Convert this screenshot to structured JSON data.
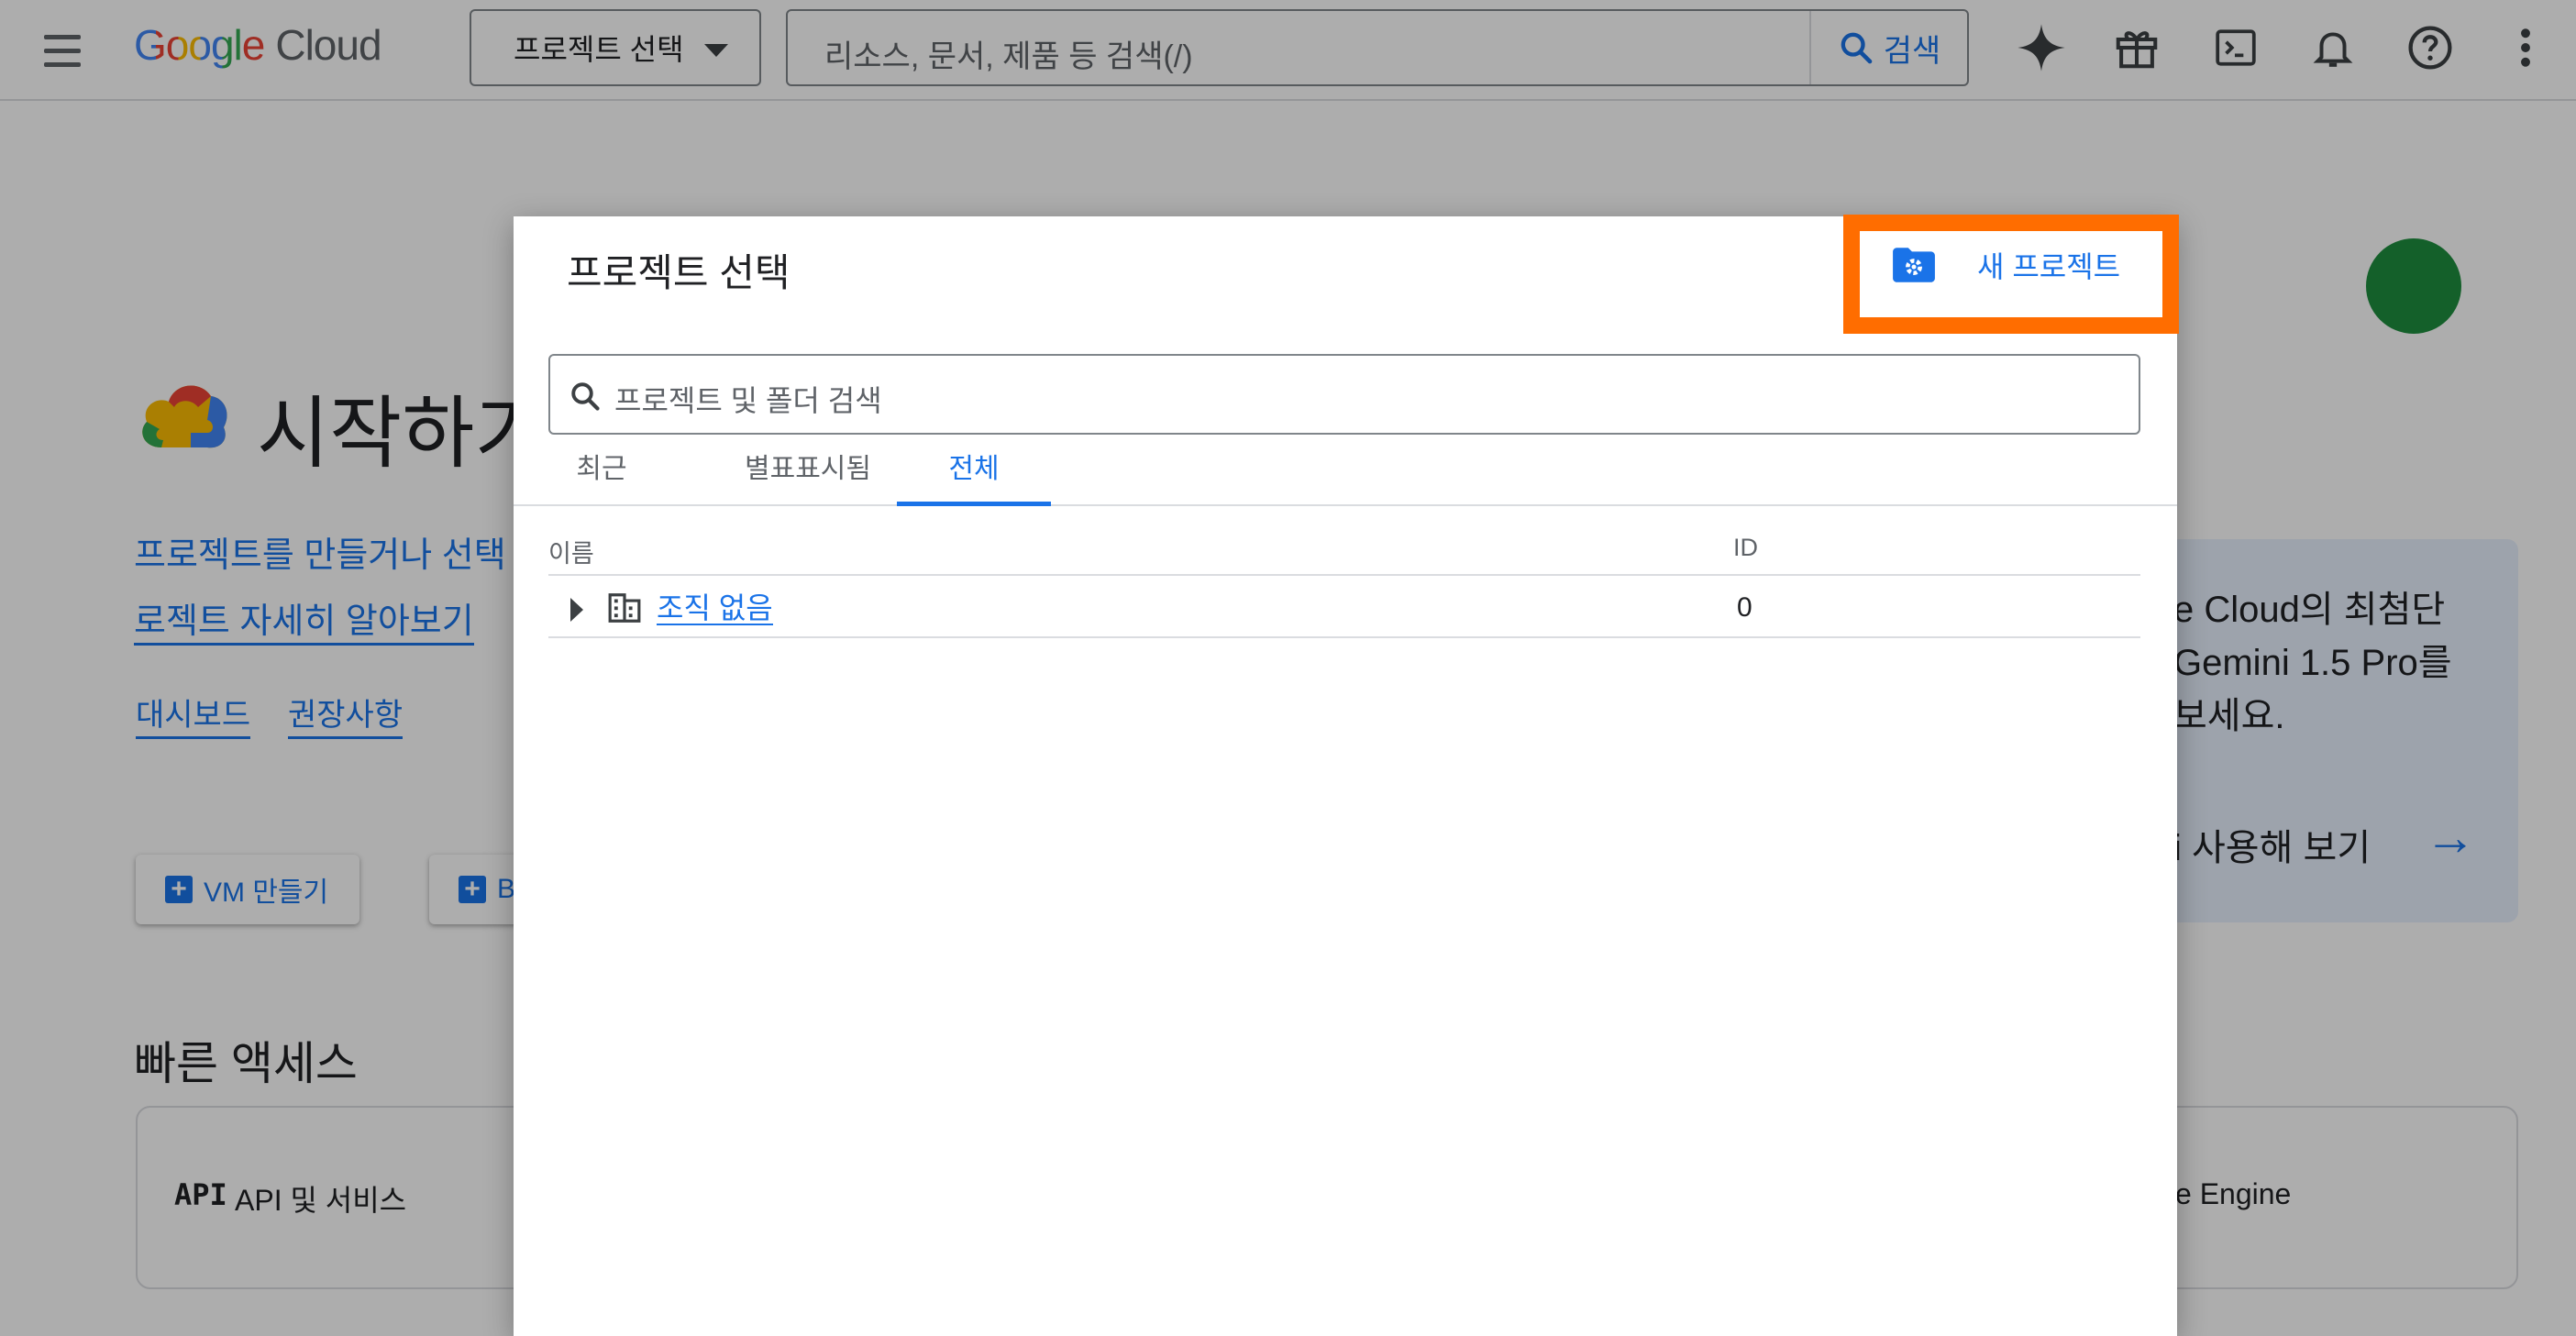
{
  "topbar": {
    "brand": "Google",
    "brand_suffix": "Cloud",
    "project_selector_label": "프로젝트 선택",
    "search_placeholder": "리소스, 문서, 제품 등 검색(/)",
    "search_button_label": "검색"
  },
  "background_page": {
    "title": "시작하기",
    "description_line1": "프로젝트를 만들거나 선택",
    "description_line2": "로젝트 자세히 알아보기",
    "links": [
      "대시보드",
      "권장사항"
    ],
    "create_vm_label": "VM 만들기",
    "second_button_label": "B",
    "quick_access_title": "빠른 액세스",
    "quick_cards": [
      "API 및 서비스",
      "e Engine"
    ],
    "api_badge": "API",
    "promo_lines": [
      "e Cloud의 최첨단",
      "Gemini 1.5 Pro를",
      "보세요."
    ],
    "promo_link": "i 사용해 보기"
  },
  "dialog": {
    "title": "프로젝트 선택",
    "new_project_label": "새 프로젝트",
    "search_placeholder": "프로젝트 및 폴더 검색",
    "tabs": [
      {
        "label": "최근",
        "active": false
      },
      {
        "label": "별표표시됨",
        "active": false
      },
      {
        "label": "전체",
        "active": true
      }
    ],
    "columns": {
      "name": "이름",
      "id": "ID"
    },
    "rows": [
      {
        "name": "조직 없음",
        "id": "0"
      }
    ]
  },
  "colors": {
    "accent": "#1a73e8",
    "highlight": "#ff6d00",
    "scrim": "rgba(0,0,0,0.32)"
  }
}
